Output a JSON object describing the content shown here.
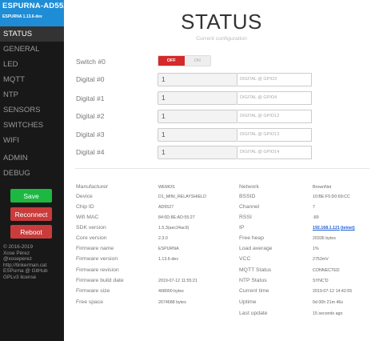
{
  "sidebar": {
    "brand": "ESPURNA-AD5527",
    "version": "ESPURNA 1.13.6-dev",
    "items": [
      {
        "label": "STATUS",
        "active": true
      },
      {
        "label": "GENERAL"
      },
      {
        "label": "LED"
      },
      {
        "label": "MQTT"
      },
      {
        "label": "NTP"
      },
      {
        "label": "SENSORS"
      },
      {
        "label": "SWITCHES"
      },
      {
        "label": "WIFI"
      },
      {
        "label": "ADMIN"
      },
      {
        "label": "DEBUG"
      }
    ],
    "buttons": {
      "save": "Save",
      "reconnect": "Reconnect",
      "reboot": "Reboot"
    },
    "buttonColors": {
      "save": "#1cb841",
      "danger": "#ca3c3c"
    },
    "footer": [
      "© 2016-2019",
      "Xose Pérez",
      "@xoseperez",
      "http://tinkerman.cat",
      "ESPurna @ GitHub",
      "GPLv3 license"
    ]
  },
  "main": {
    "title": "STATUS",
    "subtitle": "Current configuration",
    "switch": {
      "label": "Switch #0",
      "off": "OFF",
      "on": "ON",
      "state": "off"
    },
    "digitals": [
      {
        "label": "Digital #0",
        "value": "1",
        "gpio": "DIGITAL @ GPIO3"
      },
      {
        "label": "Digital #1",
        "value": "1",
        "gpio": "DIGITAL @ GPIO4"
      },
      {
        "label": "Digital #2",
        "value": "1",
        "gpio": "DIGITAL @ GPIO12"
      },
      {
        "label": "Digital #3",
        "value": "1",
        "gpio": "DIGITAL @ GPIO13"
      },
      {
        "label": "Digital #4",
        "value": "1",
        "gpio": "DIGITAL @ GPIO14"
      }
    ],
    "info_left": [
      {
        "label": "Manufacturer",
        "value": "WEMOS"
      },
      {
        "label": "Device",
        "value": "D1_MINI_RELAYSHIELD"
      },
      {
        "label": "Chip ID",
        "value": "AD5527"
      },
      {
        "label": "Wifi MAC",
        "value": "84:0D:8E:AD:55:27"
      },
      {
        "label": "SDK version",
        "value": "1.5.3(aec24ac9)"
      },
      {
        "label": "Core version",
        "value": "2.3.0"
      },
      {
        "label": "Firmware name",
        "value": "ESPURNA"
      },
      {
        "label": "Firmware version",
        "value": "1.13.6-dev"
      },
      {
        "label": "Firmware revision",
        "value": ""
      },
      {
        "label": "Firmware build date",
        "value": "2019-07-12 11:55:21"
      },
      {
        "label": "Firmware size",
        "value": "468000 bytes"
      },
      {
        "label": "Free space",
        "value": "2674688 bytes"
      }
    ],
    "info_right": [
      {
        "label": "Network",
        "value": "BrownNet"
      },
      {
        "label": "BSSID",
        "value": "10:BE:F5:D0:69:CC"
      },
      {
        "label": "Channel",
        "value": "7"
      },
      {
        "label": "RSSI",
        "value": "-89"
      },
      {
        "label": "IP",
        "value": "192.168.1.121",
        "link": true,
        "extra": "(telnet)"
      },
      {
        "label": "Free heap",
        "value": "20336 bytes"
      },
      {
        "label": "Load average",
        "value": "1%"
      },
      {
        "label": "VCC",
        "value": "2752mV"
      },
      {
        "label": "MQTT Status",
        "value": "CONNECTED"
      },
      {
        "label": "NTP Status",
        "value": "SYNC'D"
      },
      {
        "label": "Current time",
        "value": "2019-07-12 14:42:55"
      },
      {
        "label": "Uptime",
        "value": "0d 00h 21m 46s"
      },
      {
        "label": "Last update",
        "value": "15 seconds ago"
      }
    ]
  }
}
